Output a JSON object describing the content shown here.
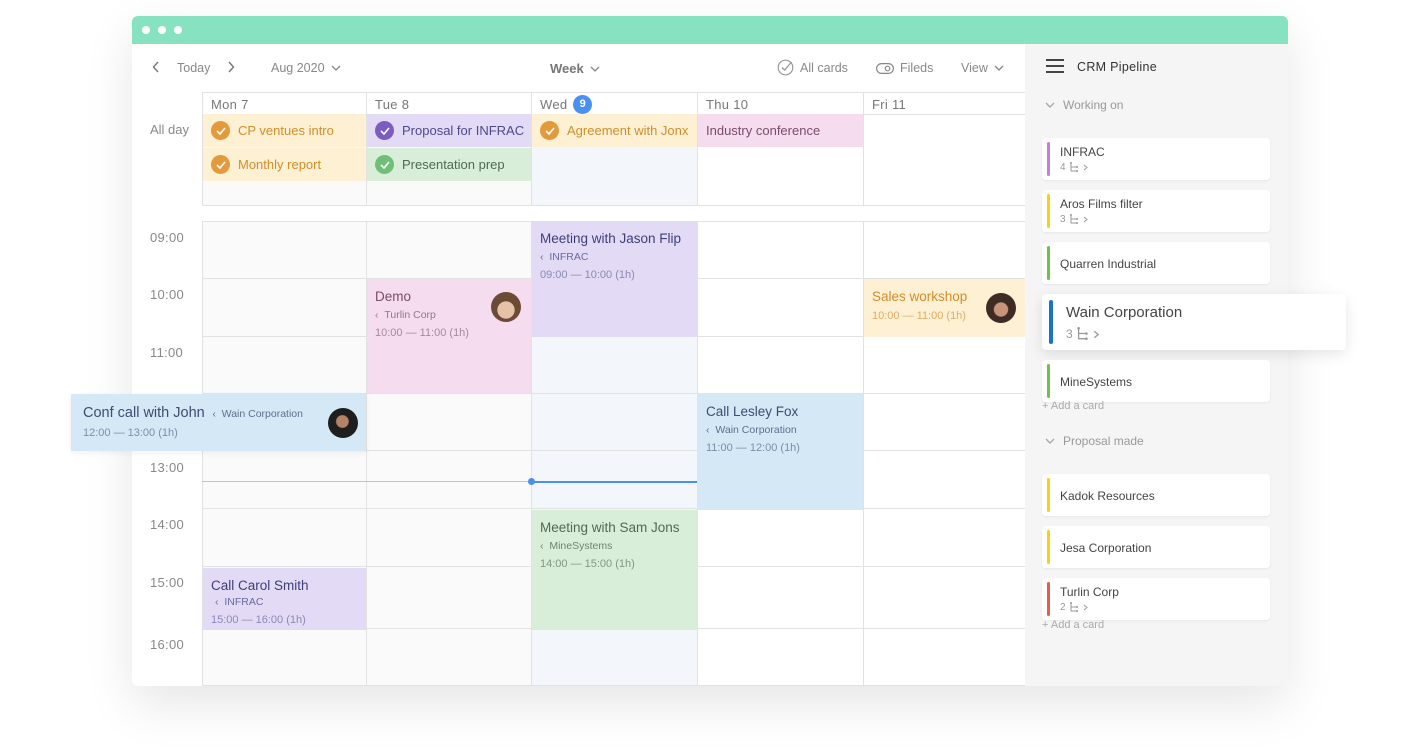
{
  "window": {
    "titlebar_color": "#86e2c1"
  },
  "toolbar": {
    "prev_icon": "chevron-left-icon",
    "today_label": "Today",
    "next_icon": "chevron-right-icon",
    "month_label": "Aug 2020",
    "view_mode_label": "Week",
    "all_cards_label": "All cards",
    "fields_label": "Fileds",
    "view_label": "View"
  },
  "calendar": {
    "allday_label": "All day",
    "today_accent": "#4a90f0",
    "days": [
      {
        "label": "Mon 7"
      },
      {
        "label": "Tue 8"
      },
      {
        "label": "Wed",
        "badge": "9"
      },
      {
        "label": "Thu 10"
      },
      {
        "label": "Fri 11"
      }
    ],
    "hours": [
      "09:00",
      "10:00",
      "11:00",
      "13:00",
      "14:00",
      "15:00",
      "16:00"
    ],
    "allday_events": [
      {
        "title": "CP ventues intro",
        "done": true
      },
      {
        "title": "Monthly report",
        "done": true
      },
      {
        "title": "Proposal for INFRAC",
        "done": true
      },
      {
        "title": "Presentation prep",
        "done": true
      },
      {
        "title": "Agreement with Jonx",
        "done": true
      },
      {
        "title": "Industry conference",
        "done": false
      }
    ],
    "events": {
      "jason": {
        "title": "Meeting with Jason Flip",
        "client": "INFRAC",
        "time": "09:00 — 10:00 (1h)"
      },
      "demo": {
        "title": "Demo",
        "client": "Turlin Corp",
        "time": "10:00 — 11:00 (1h)"
      },
      "sales": {
        "title": "Sales workshop",
        "time": "10:00 — 11:00 (1h)"
      },
      "conf": {
        "title": "Conf call with John",
        "client": "Wain Corporation",
        "time": "12:00 — 13:00 (1h)"
      },
      "lesley": {
        "title": "Call Lesley Fox",
        "client": "Wain Corporation",
        "time": "11:00 — 12:00 (1h)"
      },
      "sam": {
        "title": "Meeting with Sam Jons",
        "client": "MineSystems",
        "time": "14:00 — 15:00 (1h)"
      },
      "carol": {
        "title": "Call Carol Smith",
        "client": "INFRAC",
        "time": "15:00 — 16:00 (1h)"
      }
    }
  },
  "sidebar": {
    "title": "CRM Pipeline",
    "groups": [
      {
        "label": "Working on",
        "cards": [
          {
            "name": "INFRAC",
            "count": "4",
            "color": "#c77de0"
          },
          {
            "name": "Aros Films filter",
            "count": "3",
            "color": "#f2d413"
          },
          {
            "name": "Quarren Industrial",
            "color": "#6cc24a"
          },
          {
            "name": "Wain Corporation",
            "count": "3",
            "color": "#1a73c8"
          },
          {
            "name": "MineSystems",
            "color": "#6cc24a"
          }
        ],
        "add_label": "+ Add a card"
      },
      {
        "label": "Proposal made",
        "cards": [
          {
            "name": "Kadok Resources",
            "color": "#f2d413"
          },
          {
            "name": "Jesa Corporation",
            "color": "#f2d413"
          },
          {
            "name": "Turlin Corp",
            "count": "2",
            "color": "#ec5a4a"
          }
        ],
        "add_label": "+ Add a card"
      }
    ]
  }
}
